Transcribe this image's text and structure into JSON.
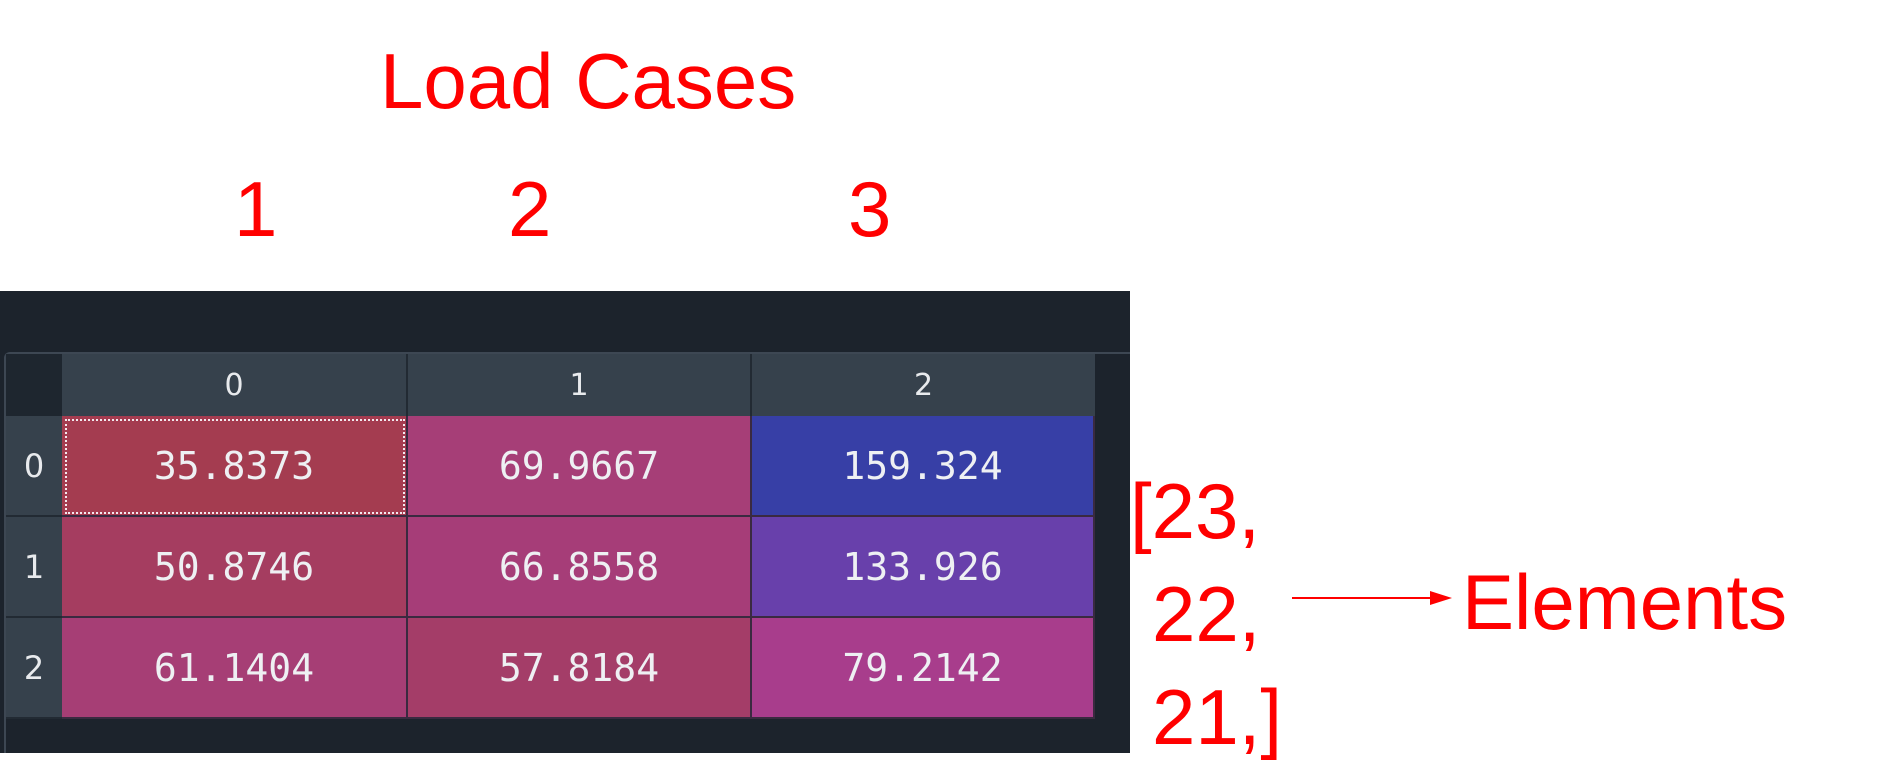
{
  "annotations": {
    "title": "Load Cases",
    "load_case_numbers": [
      "1",
      "2",
      "3"
    ],
    "element_list": [
      "[23,",
      "22,",
      "21,]"
    ],
    "elements_label": "Elements"
  },
  "table": {
    "column_headers": [
      "0",
      "1",
      "2"
    ],
    "row_headers": [
      "0",
      "1",
      "2"
    ],
    "rows": [
      [
        "35.8373",
        "69.9667",
        "159.324"
      ],
      [
        "50.8746",
        "66.8558",
        "133.926"
      ],
      [
        "61.1404",
        "57.8184",
        "79.2142"
      ]
    ],
    "cell_colors": [
      [
        "#a43c50",
        "#a63e77",
        "#373fa6"
      ],
      [
        "#a53d60",
        "#a63d78",
        "#6840ab"
      ],
      [
        "#a63e75",
        "#a43d68",
        "#a83d8c"
      ]
    ],
    "selected_cell": "0,0"
  },
  "colors": {
    "annotation": "#ff0000",
    "widget_background": "#1c232c",
    "header_background": "#36414c"
  }
}
